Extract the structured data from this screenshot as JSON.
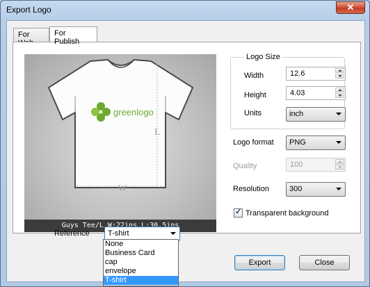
{
  "window": {
    "title": "Export Logo",
    "close_glyph": "✕"
  },
  "tabs": [
    {
      "label": "For Web",
      "active": false
    },
    {
      "label": "For Publish",
      "active": true
    }
  ],
  "preview": {
    "logo_text": "greenlogo",
    "height_marker": "L",
    "width_marker": "W",
    "caption": "Guys Tee/L W:22ins L:30.5ins"
  },
  "logo_size": {
    "group_label": "Logo Size",
    "width_label": "Width",
    "width_value": "12.6",
    "height_label": "Height",
    "height_value": "4.03",
    "units_label": "Units",
    "units_value": "inch"
  },
  "format": {
    "label": "Logo format",
    "value": "PNG"
  },
  "quality": {
    "label": "Quality",
    "value": "100",
    "enabled": false
  },
  "resolution": {
    "label": "Resolution",
    "value": "300"
  },
  "transparent": {
    "label": "Transparent background",
    "checked": true,
    "check_glyph": "✓"
  },
  "reference": {
    "label": "Reference",
    "value": "T-shirt",
    "options": [
      "None",
      "Business Card",
      "cap",
      "envelope",
      "T-shirt"
    ],
    "selected_index": 4
  },
  "buttons": {
    "export": "Export",
    "close": "Close"
  },
  "colors": {
    "logo_green": "#6cab2f",
    "selection": "#3399ff",
    "caption_bg": "#3b3b3b"
  }
}
